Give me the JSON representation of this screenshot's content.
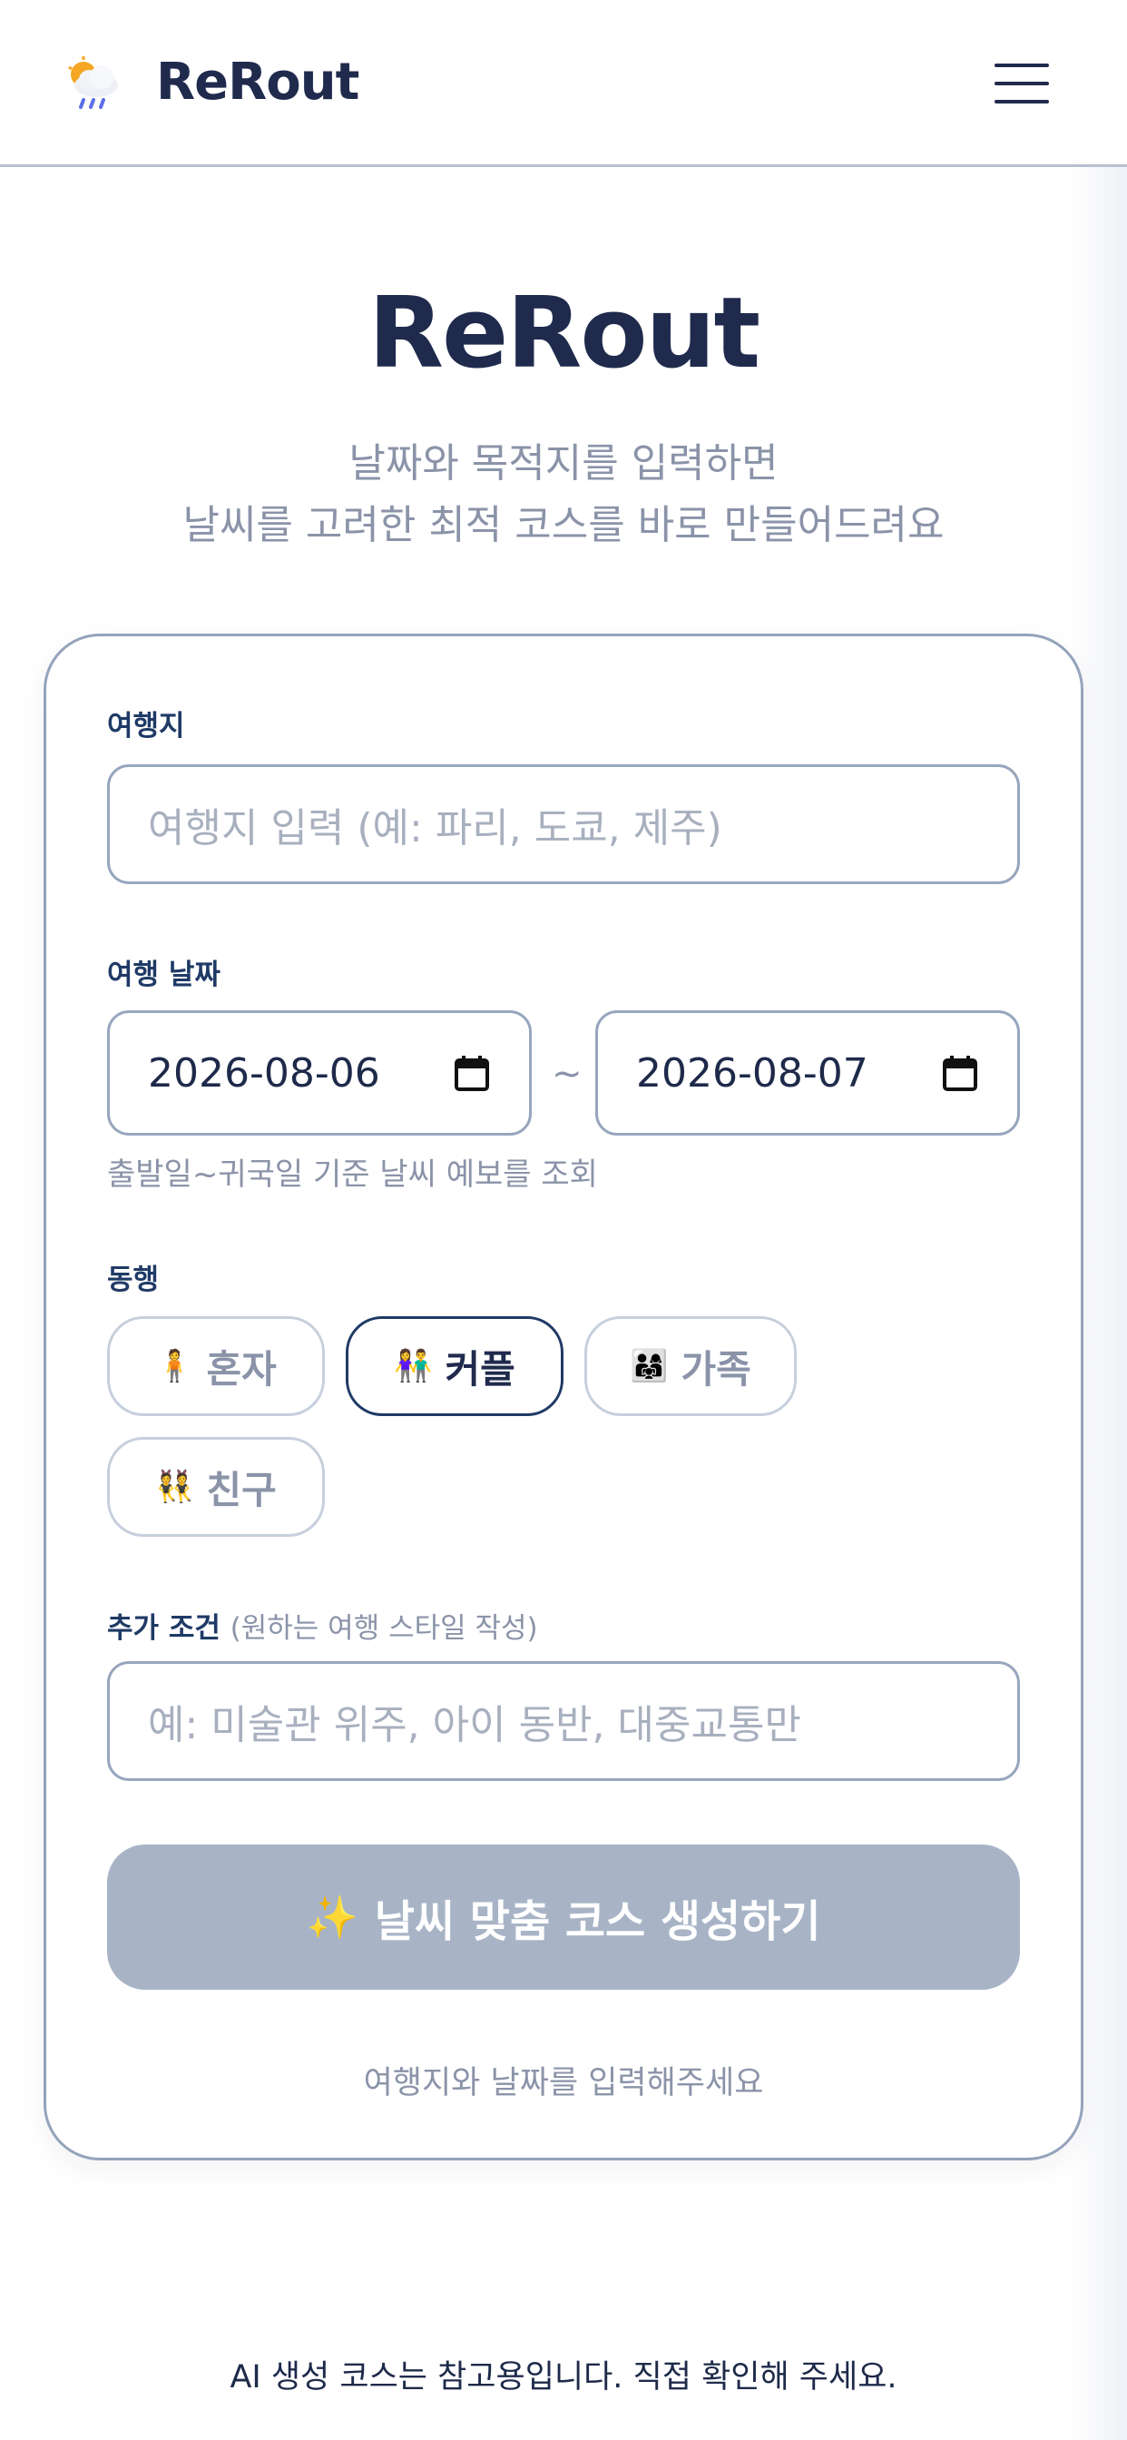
{
  "header": {
    "logo_text": "ReRout",
    "logo_icon": "cloud-sun-rain-icon",
    "menu_icon": "hamburger-menu-icon"
  },
  "hero": {
    "title": "ReRout",
    "subtitle_line1": "날짜와 목적지를 입력하면",
    "subtitle_line2": "날씨를 고려한 최적 코스를 바로 만들어드려요"
  },
  "form": {
    "destination": {
      "label": "여행지",
      "placeholder": "여행지 입력 (예: 파리, 도쿄, 제주)",
      "value": ""
    },
    "dates": {
      "label": "여행 날짜",
      "start": "2026-08-06",
      "end": "2026-08-07",
      "separator": "~",
      "help": "출발일~귀국일 기준 날씨 예보를 조회"
    },
    "companion": {
      "label": "동행",
      "options": [
        {
          "emoji": "🧍",
          "label": "혼자",
          "selected": false
        },
        {
          "emoji": "👫",
          "label": "커플",
          "selected": true
        },
        {
          "emoji": "👨‍👩‍👧",
          "label": "가족",
          "selected": false
        },
        {
          "emoji": "👯",
          "label": "친구",
          "selected": false
        }
      ]
    },
    "extra": {
      "label": "추가 조건",
      "hint": "(원하는 여행 스타일 작성)",
      "placeholder": "예: 미술관 위주, 아이 동반, 대중교통만",
      "value": ""
    },
    "submit": {
      "icon": "✨",
      "label": "날씨 맞춤 코스 생성하기",
      "disabled": true
    },
    "notice": "여행지와 날짜를 입력해주세요"
  },
  "footer": {
    "disclaimer": "AI 생성 코스는 참고용입니다. 직접 확인해 주세요."
  },
  "colors": {
    "primary": "#1f2a4d",
    "muted": "#8a93a8",
    "border": "#97a6bd",
    "button_disabled": "#a8b4c6"
  }
}
